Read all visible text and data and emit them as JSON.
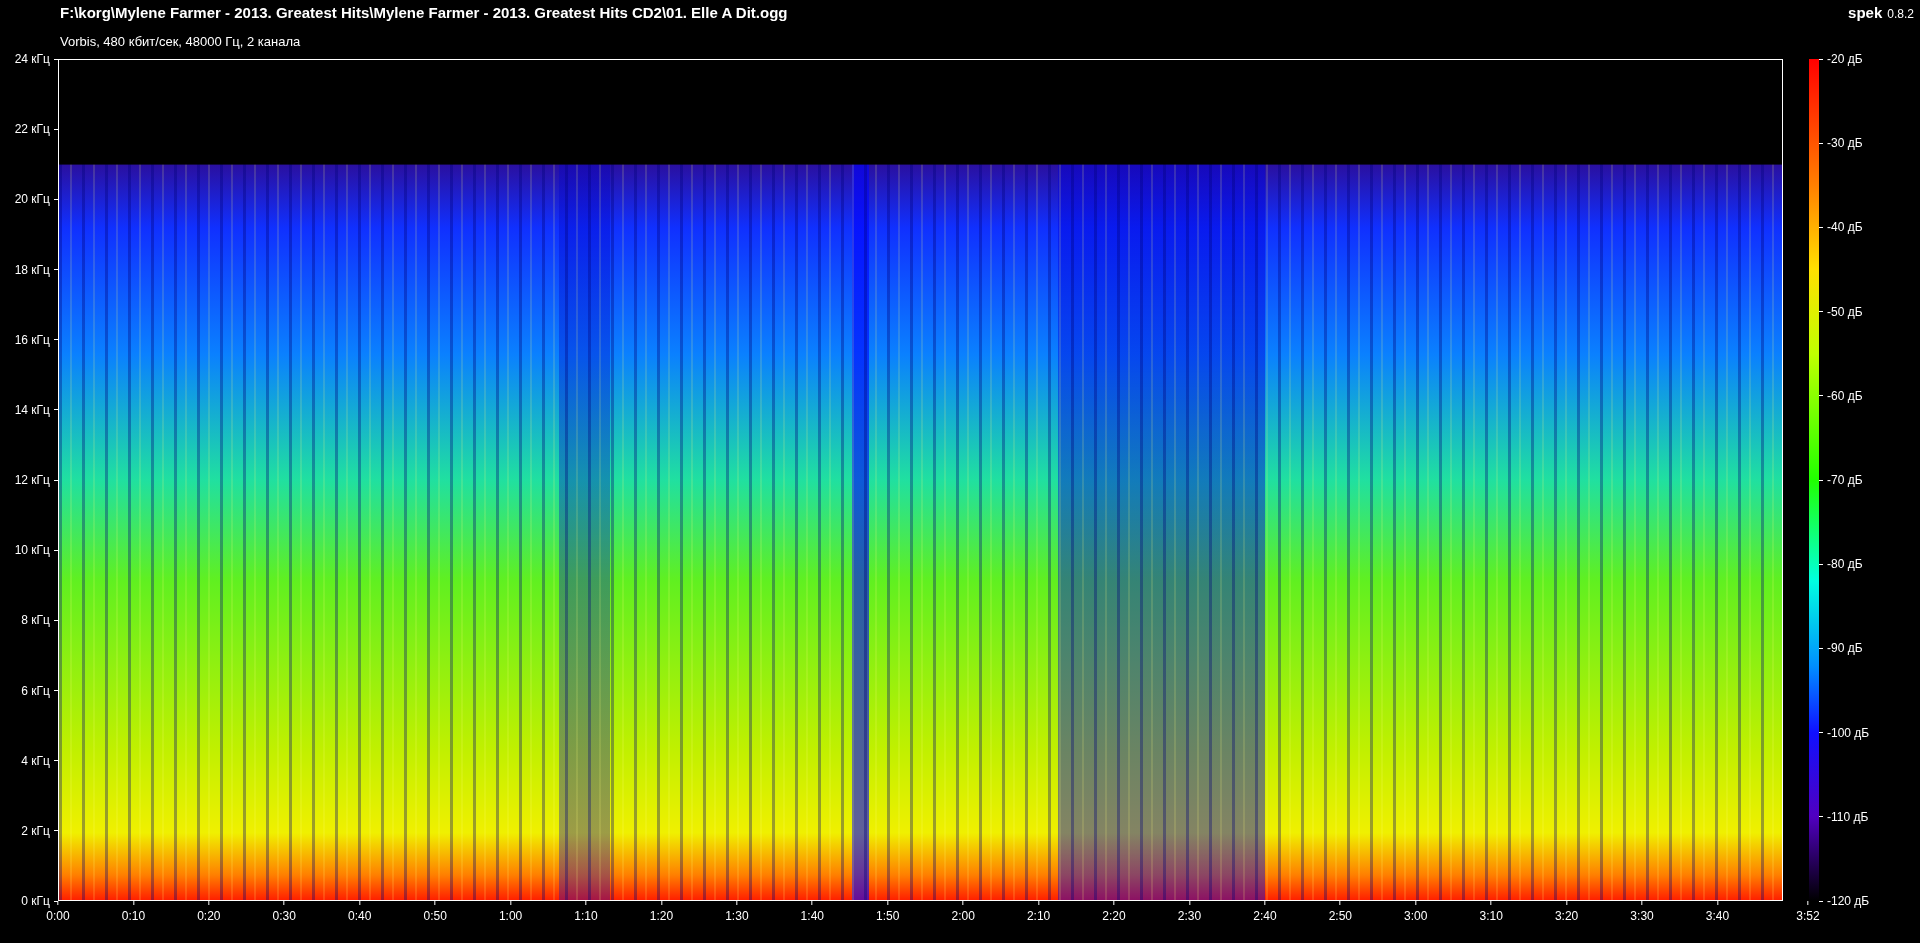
{
  "header": {
    "title": "F:\\korg\\Mylene Farmer - 2013. Greatest Hits\\Mylene Farmer - 2013. Greatest Hits CD2\\01. Elle A Dit.ogg",
    "app_name": "spek",
    "app_version": "0.8.2",
    "subtitle": "Vorbis, 480 кбит/сек, 48000 Гц, 2 канала"
  },
  "frequency_axis": [
    "24 кГц",
    "22 кГц",
    "20 кГц",
    "18 кГц",
    "16 кГц",
    "14 кГц",
    "12 кГц",
    "10 кГц",
    "8 кГц",
    "6 кГц",
    "4 кГц",
    "2 кГц",
    "0 кГц"
  ],
  "time_axis": {
    "ticks": [
      "0:00",
      "0:10",
      "0:20",
      "0:30",
      "0:40",
      "0:50",
      "1:00",
      "1:10",
      "1:20",
      "1:30",
      "1:40",
      "1:50",
      "2:00",
      "2:10",
      "2:20",
      "2:30",
      "2:40",
      "2:50",
      "3:00",
      "3:10",
      "3:20",
      "3:30",
      "3:40"
    ],
    "end": "3:52"
  },
  "level_legend": [
    "-20 дБ",
    "-30 дБ",
    "-40 дБ",
    "-50 дБ",
    "-60 дБ",
    "-70 дБ",
    "-80 дБ",
    "-90 дБ",
    "-100 дБ",
    "-110 дБ",
    "-120 дБ"
  ]
}
